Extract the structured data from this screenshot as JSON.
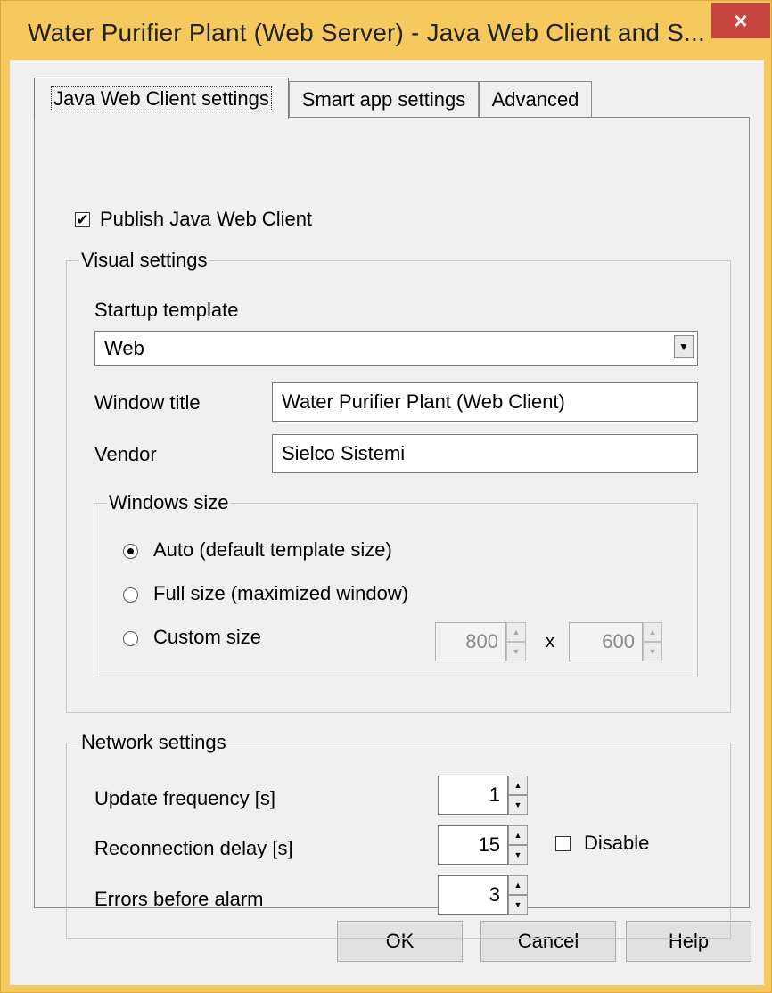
{
  "window": {
    "title": "Water Purifier Plant (Web Server) - Java Web Client and S...",
    "close_glyph": "×"
  },
  "tabs": [
    {
      "label": "Java Web Client settings",
      "active": true
    },
    {
      "label": "Smart app settings",
      "active": false
    },
    {
      "label": "Advanced",
      "active": false
    }
  ],
  "publish": {
    "label": "Publish Java Web Client",
    "checked": true,
    "check_glyph": "✔"
  },
  "visual": {
    "title": "Visual settings",
    "startup_template": {
      "label": "Startup template",
      "value": "Web"
    },
    "window_title": {
      "label": "Window title",
      "value": "Water Purifier Plant (Web Client)"
    },
    "vendor": {
      "label": "Vendor",
      "value": "Sielco Sistemi"
    },
    "windows_size": {
      "title": "Windows size",
      "options": [
        {
          "label": "Auto (default template size)",
          "selected": true
        },
        {
          "label": "Full size (maximized window)",
          "selected": false
        },
        {
          "label": "Custom size",
          "selected": false
        }
      ],
      "custom_width": "800",
      "separator": "x",
      "custom_height": "600"
    }
  },
  "network": {
    "title": "Network settings",
    "update_frequency": {
      "label": "Update frequency [s]",
      "value": "1"
    },
    "reconnection_delay": {
      "label": "Reconnection delay [s]",
      "value": "15"
    },
    "disable": {
      "label": "Disable",
      "checked": false
    },
    "errors_before_alarm": {
      "label": "Errors before alarm",
      "value": "3"
    }
  },
  "buttons": {
    "ok": "OK",
    "cancel": "Cancel",
    "help": "Help"
  },
  "icons": {
    "spin_up": "▲",
    "spin_down": "▼",
    "dropdown": "▼"
  },
  "colors": {
    "title_bar": "#f5c95e",
    "close_button": "#c7453f",
    "dialog_bg": "#f0f0f0"
  }
}
